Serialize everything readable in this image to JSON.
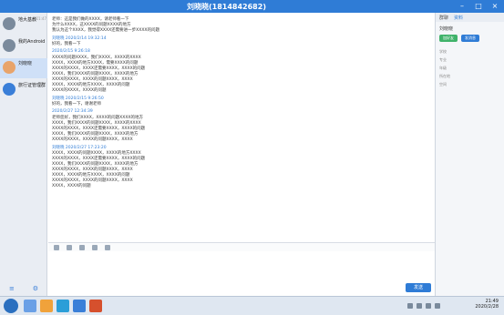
{
  "window": {
    "title": "刘晓晓(1814842682)"
  },
  "sidebar": {
    "conversations": [
      {
        "name": "地大基教",
        "preview": "",
        "time": "21:47"
      },
      {
        "name": "我的Android",
        "preview": "",
        "time": ""
      },
      {
        "name": "刘晓晓",
        "preview": "",
        "time": ""
      },
      {
        "name": "旅行证管理群",
        "preview": "",
        "time": ""
      }
    ]
  },
  "messages": [
    {
      "header": "",
      "lines": [
        "老师：这是我们做的XXXX，请老师看一下",
        "为什么XXXX，这XXXX的问题XXXX的地方",
        "我认为这个XXXX，我觉得XXXX还需要进一步XXXX的问题"
      ]
    },
    {
      "header": "刘晓晓 2020/2/14 19:32:14",
      "lines": [
        "好的，我看一下"
      ]
    },
    {
      "header": "2020/2/15 9:26:18",
      "lines": [
        "XXXX的问题XXXX，我们XXXX，XXXX的XXXX",
        "XXXX，XXXX的地方XXXX，需要XXXX的问题",
        "XXXX的XXXX，XXXX还需要XXXX，XXXX的问题",
        "XXXX，我们XXXX的问题XXXX，XXXX的地方",
        "XXXX的XXXX，XXXX的问题XXXX，XXXX",
        "XXXX，XXXX的地方XXXX，XXXX的问题",
        "XXXX的XXXX，XXXX的问题"
      ]
    },
    {
      "header": "刘晓晓 2020/2/15 9:26:50",
      "lines": [
        "好的，我看一下，谢谢老师"
      ]
    },
    {
      "header": "2020/2/27 12:34:39",
      "lines": [
        "老师您好，我们XXXX，XXXX的问题XXXX的地方",
        "XXXX，我们XXXX的问题XXXX，XXXX的XXXX",
        "XXXX的XXXX，XXXX还需要XXXX，XXXX的问题",
        "XXXX，我们XXXX的问题XXXX，XXXX的地方",
        "XXXX的XXXX，XXXX的问题XXXX，XXXX"
      ]
    },
    {
      "header": "刘晓晓 2020/2/27 17:23:20",
      "lines": [
        "XXXX，XXXX的问题XXXX，XXXX的地方XXXX",
        "XXXX的XXXX，XXXX还需要XXXX，XXXX的问题",
        "XXXX，我们XXXX的问题XXXX，XXXX的地方",
        "XXXX的XXXX，XXXX的问题XXXX，XXXX",
        "XXXX，XXXX的地方XXXX，XXXX的问题",
        "XXXX的XXXX，XXXX的问题XXXX，XXXX",
        "XXXX，XXXX的问题"
      ]
    }
  ],
  "composer": {
    "send_label": "发送"
  },
  "right_panel": {
    "tabs": [
      "群聊",
      "资料"
    ],
    "contact_name": "刘晓晓",
    "buttons": {
      "add": "加好友",
      "chat": "发消息"
    },
    "info": [
      {
        "key": "学校",
        "value": ""
      },
      {
        "key": "专业",
        "value": ""
      },
      {
        "key": "年级",
        "value": ""
      },
      {
        "key": "所在地",
        "value": ""
      },
      {
        "key": "空间",
        "value": ""
      }
    ],
    "colors": {
      "accent": "#2f7cd6",
      "accent_green": "#3fb26a"
    }
  },
  "taskbar": {
    "time": "21:49",
    "date": "2020/2/28"
  }
}
